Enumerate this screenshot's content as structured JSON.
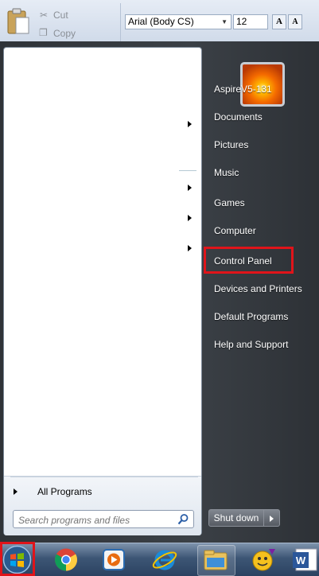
{
  "ribbon": {
    "cut_label": "Cut",
    "copy_label": "Copy",
    "font_name": "Arial (Body CS)",
    "font_size": "12",
    "grow_font": "A",
    "shrink_font": "A"
  },
  "start_menu": {
    "user_name": "AspireV5-131",
    "right_items": [
      "Documents",
      "Pictures",
      "Music",
      "Games",
      "Computer",
      "Control Panel",
      "Devices and Printers",
      "Default Programs",
      "Help and Support"
    ],
    "all_programs": "All Programs",
    "search_placeholder": "Search programs and files",
    "shutdown_label": "Shut down"
  },
  "taskbar": {
    "icons": [
      "start-orb",
      "chrome-icon",
      "media-player-icon",
      "internet-explorer-icon",
      "windows-explorer-icon",
      "yahoo-messenger-icon",
      "word-icon"
    ]
  },
  "colors": {
    "highlight": "#e0141a",
    "menu_dark": "#3b4046",
    "taskbar": "#3d5675"
  }
}
